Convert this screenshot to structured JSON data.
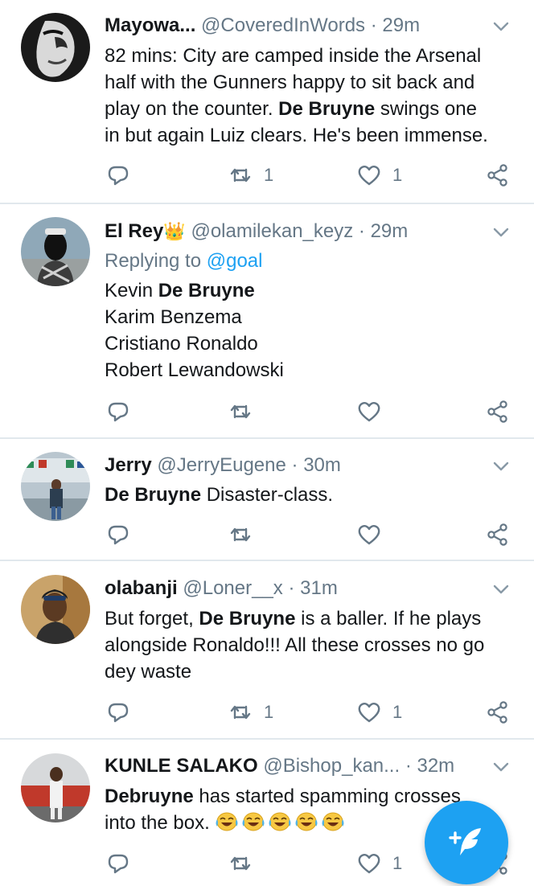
{
  "tweets": [
    {
      "name": "Mayowa...",
      "handle": "@CoveredInWords",
      "time": "· 29m",
      "body_lines": [
        [
          {
            "t": "82 mins: City are camped inside the Arsenal"
          }
        ],
        [
          {
            "t": "half with the Gunners happy to sit back and"
          }
        ],
        [
          {
            "t": "play on the counter. "
          },
          {
            "t": "De Bruyne",
            "b": true
          },
          {
            "t": " swings one"
          }
        ],
        [
          {
            "t": "in but again Luiz clears. He's been immense."
          }
        ]
      ],
      "retweets": "1",
      "likes": "1"
    },
    {
      "name": "El Rey",
      "name_emoji": "👑",
      "handle": "@olamilekan_keyz",
      "time": "· 29m",
      "replying_prefix": "Replying to",
      "replying_to": "@goal",
      "body_lines": [
        [
          {
            "t": "Kevin "
          },
          {
            "t": "De Bruyne",
            "b": true
          }
        ],
        [
          {
            "t": "Karim Benzema"
          }
        ],
        [
          {
            "t": "Cristiano Ronaldo"
          }
        ],
        [
          {
            "t": "Robert Lewandowski"
          }
        ]
      ],
      "retweets": "",
      "likes": ""
    },
    {
      "name": "Jerry",
      "handle": "@JerryEugene",
      "time": "· 30m",
      "body_lines": [
        [
          {
            "t": "De Bruyne",
            "b": true
          },
          {
            "t": " Disaster-class."
          }
        ]
      ],
      "retweets": "",
      "likes": ""
    },
    {
      "name": "olabanji",
      "handle": "@Loner__x",
      "time": "· 31m",
      "body_lines": [
        [
          {
            "t": "But forget, "
          },
          {
            "t": "De Bruyne",
            "b": true
          },
          {
            "t": " is a baller. If he plays"
          }
        ],
        [
          {
            "t": "alongside Ronaldo!!! All these crosses no go"
          }
        ],
        [
          {
            "t": "dey waste"
          }
        ]
      ],
      "retweets": "1",
      "likes": "1"
    },
    {
      "name": "KUNLE SALAKO",
      "handle": "@Bishop_kan...",
      "time": "· 32m",
      "body_lines": [
        [
          {
            "t": "Debruyne",
            "b": true
          },
          {
            "t": " has started spamming crosses"
          }
        ],
        [
          {
            "t": "into the box. "
          },
          {
            "emoji": "face-with-tears-of-joy",
            "count": 5
          }
        ]
      ],
      "retweets": "",
      "likes": "1"
    }
  ],
  "icons": {
    "reply": "reply-icon",
    "retweet": "retweet-icon",
    "like": "heart-icon",
    "share": "share-icon",
    "caret": "chevron-down-icon",
    "compose": "compose-tweet-icon"
  },
  "colors": {
    "accent": "#1da1f2",
    "text": "#14171a",
    "muted": "#657786",
    "divider": "#e1e8ed"
  }
}
